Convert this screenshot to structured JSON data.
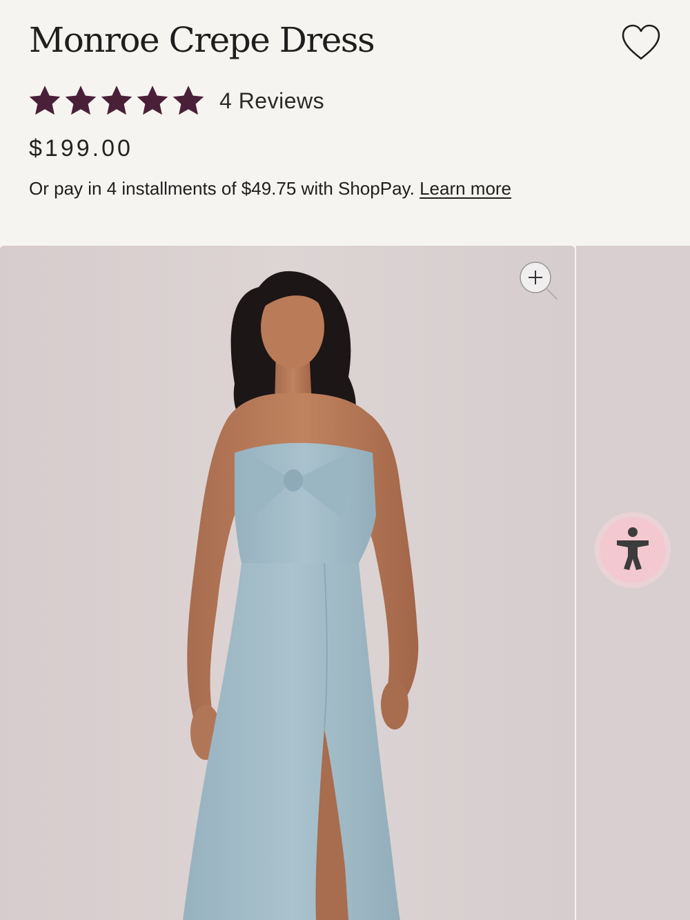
{
  "product": {
    "title": "Monroe Crepe Dress",
    "rating": 5,
    "rating_max": 5,
    "reviews_label": "4 Reviews",
    "price": "$199.00",
    "installments_text": "Or pay in 4 installments of $49.75 with ShopPay.",
    "learn_more_label": "Learn more"
  },
  "icons": {
    "wishlist": "heart-outline-icon",
    "star": "star-filled-icon",
    "zoom": "zoom-in-icon",
    "accessibility": "accessibility-icon"
  },
  "colors": {
    "background": "#f6f4f0",
    "star": "#4a2039",
    "text": "#1e1e1e",
    "image_background": "#d9cfd0",
    "dress": "#a3bdc9",
    "accessibility_button": "#f3c6cf"
  }
}
